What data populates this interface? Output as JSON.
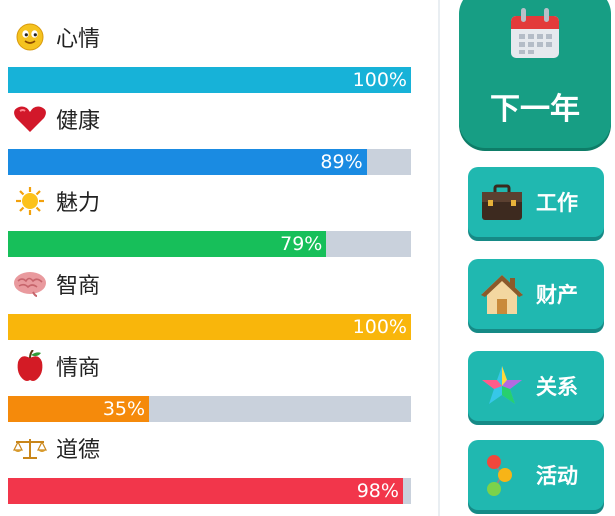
{
  "stats": [
    {
      "label": "心情",
      "value": "100%",
      "fraction": 1.0,
      "color": "#17b2d8",
      "icon": "smiley-icon"
    },
    {
      "label": "健康",
      "value": "89%",
      "fraction": 0.89,
      "color": "#1a8be2",
      "icon": "heart-icon"
    },
    {
      "label": "魅力",
      "value": "79%",
      "fraction": 0.79,
      "color": "#17bf5a",
      "icon": "sun-icon"
    },
    {
      "label": "智商",
      "value": "100%",
      "fraction": 1.0,
      "color": "#f9b60b",
      "icon": "brain-icon"
    },
    {
      "label": "情商",
      "value": "35%",
      "fraction": 0.35,
      "color": "#f58a0b",
      "icon": "apple-icon"
    },
    {
      "label": "道德",
      "value": "98%",
      "fraction": 0.98,
      "color": "#f2364b",
      "icon": "scales-icon"
    }
  ],
  "next_year": {
    "label": "下一年",
    "icon": "calendar-icon"
  },
  "actions": [
    {
      "label": "工作",
      "icon": "briefcase-icon"
    },
    {
      "label": "财产",
      "icon": "house-icon"
    },
    {
      "label": "关系",
      "icon": "star-icon"
    },
    {
      "label": "活动",
      "icon": "dots-icon"
    }
  ]
}
